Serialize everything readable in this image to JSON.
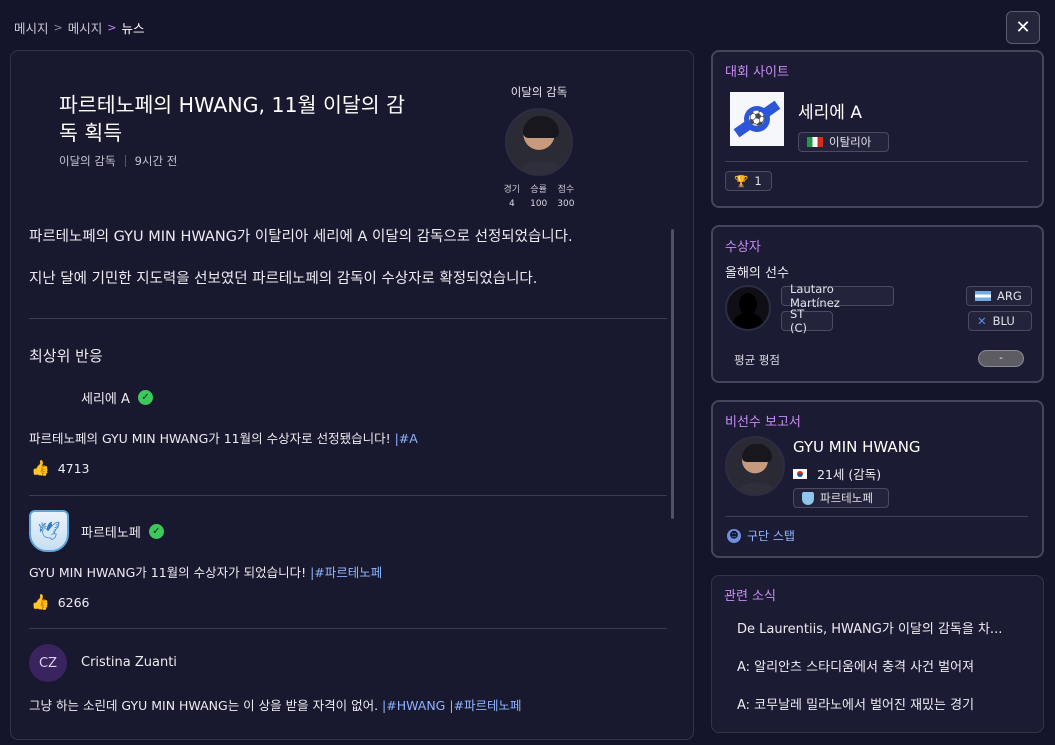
{
  "breadcrumb": {
    "item1": "메시지",
    "item2": "메시지",
    "current": "뉴스"
  },
  "close_label": "✕",
  "article": {
    "headline": "파르테노페의 HWANG, 11월 이달의 감독 획득",
    "category": "이달의 감독",
    "time": "9시간 전",
    "award_title": "이달의 감독",
    "stats": [
      {
        "label": "경기",
        "value": "4"
      },
      {
        "label": "승률",
        "value": "100"
      },
      {
        "label": "점수",
        "value": "300"
      }
    ],
    "paragraph1": "파르테노페의 GYU MIN HWANG가 이탈리아 세리에 A 이달의 감독으로 선정되었습니다.",
    "paragraph2": "지난 달에 기민한 지도력을 선보였던 파르테노페의 감독이 수상자로 확정되었습니다."
  },
  "reactions": {
    "title": "최상위 반응",
    "posts": [
      {
        "author": "세리에 A",
        "text": "파르테노페의 GYU MIN HWANG가 11월의 수상자로 선정됐습니다! ",
        "tags": [
          "|#A"
        ],
        "likes": "4713"
      },
      {
        "author": "파르테노페",
        "text": "GYU MIN HWANG가 11월의 수상자가 되었습니다! ",
        "tags": [
          "|#파르테노페"
        ],
        "likes": "6266"
      },
      {
        "author": "Cristina Zuanti",
        "initials": "CZ",
        "text": "그냥 하는 소린데 GYU MIN HWANG는 이 상을 받을 자격이 없어. ",
        "tags": [
          "|#HWANG",
          "|#파르테노페"
        ]
      }
    ]
  },
  "competition": {
    "title": "대회 사이트",
    "name": "세리에 A",
    "country": "이탈리아",
    "trophies": "1"
  },
  "winner": {
    "title": "수상자",
    "subtitle": "올해의 선수",
    "player": "Lautaro Martínez",
    "position": "ST (C)",
    "nation": "ARG",
    "club": "BLU",
    "avg_rating_label": "평균 평점",
    "avg_rating": "-"
  },
  "staff_report": {
    "title": "비선수 보고서",
    "name": "GYU MIN HWANG",
    "age_role": "21세 (감독)",
    "club": "파르테노페",
    "link": "구단 스탭"
  },
  "related": {
    "title": "관련 소식",
    "items": [
      "De Laurentiis, HWANG가 이달의 감독을 차...",
      "A: 알리안츠 스타디움에서 충격 사건 벌어져",
      "A: 코무날레 밀라노에서 벌어진 재밌는 경기"
    ]
  },
  "colors": {
    "accent": "#c98cf5",
    "link": "#8fb4ff",
    "verified": "#3cc85a",
    "background": "#14142a"
  }
}
